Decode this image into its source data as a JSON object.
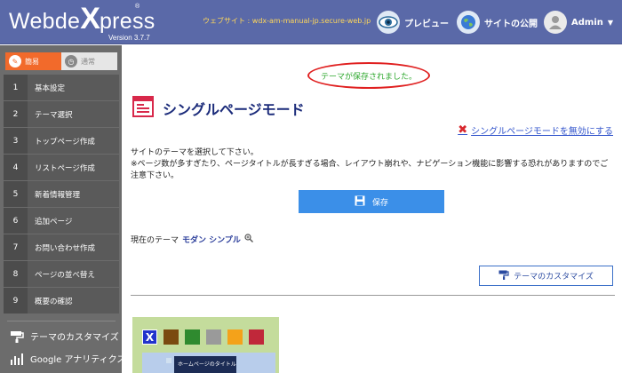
{
  "header": {
    "logo_text_pre": "Webde",
    "logo_text_x": "X",
    "logo_text_post": "press",
    "logo_reg": "®",
    "version": "Version 3.7.7",
    "site_url": "ウェブサイト : wdx-am-manual-jp.secure-web.jp",
    "preview_label": "プレビュー",
    "publish_label": "サイトの公開",
    "admin_label": "Admin",
    "colors": {
      "bar": "#5a69a8",
      "url": "#ffd75a"
    }
  },
  "sidebar": {
    "mode_tabs": [
      {
        "label": "簡易",
        "icon": "pencil-icon",
        "active": true
      },
      {
        "label": "通常",
        "icon": "compass-icon",
        "active": false
      }
    ],
    "items": [
      {
        "num": "1",
        "label": "基本設定"
      },
      {
        "num": "2",
        "label": "テーマ選択"
      },
      {
        "num": "3",
        "label": "トップページ作成"
      },
      {
        "num": "4",
        "label": "リストページ作成"
      },
      {
        "num": "5",
        "label": "新着情報管理"
      },
      {
        "num": "6",
        "label": "追加ページ"
      },
      {
        "num": "7",
        "label": "お問い合わせ作成"
      },
      {
        "num": "8",
        "label": "ページの並べ替え"
      },
      {
        "num": "9",
        "label": "概要の確認"
      }
    ],
    "customize_label": "テーマのカスタマイズ",
    "analytics_label": "Google アナリティクス",
    "accent": "#f26a2b"
  },
  "main": {
    "saved_message": "テーマが保存されました。",
    "title": "シングルページモード",
    "disable_link": "シングルページモードを無効にする",
    "desc_line1": "サイトのテーマを選択して下さい。",
    "desc_line2": "※ページ数が多すぎたり、ページタイトルが長すぎる場合、レイアウト崩れや、ナビゲーション機能に影響する恐れがありますのでご注意下さい。",
    "save_label": "保存",
    "current_theme_label": "現在のテーマ",
    "current_theme_name": "モダン シンプル",
    "customize_button": "テーマのカスタマイズ",
    "preview": {
      "swatches": [
        "#2233cc",
        "#7a4a10",
        "#2f8a2f",
        "#9a9a9a",
        "#f4a21a",
        "#c0283a"
      ],
      "heading": "ホームページのタイトル"
    }
  }
}
